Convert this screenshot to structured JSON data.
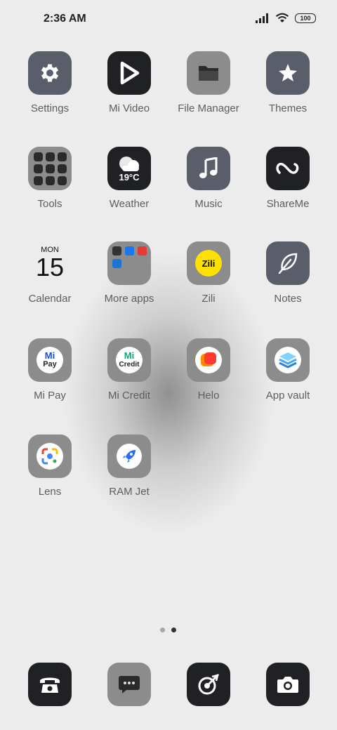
{
  "status": {
    "time": "2:36 AM",
    "battery": "100"
  },
  "apps": {
    "settings": "Settings",
    "mi_video": "Mi Video",
    "file_manager": "File Manager",
    "themes": "Themes",
    "tools": "Tools",
    "weather": "Weather",
    "weather_temp": "19°C",
    "music": "Music",
    "shareme": "ShareMe",
    "calendar": "Calendar",
    "calendar_day": "MON",
    "calendar_date": "15",
    "more_apps": "More apps",
    "zili": "Zili",
    "zili_logo": "Zili",
    "notes": "Notes",
    "mi_pay": "Mi Pay",
    "mi_pay_logo_top": "Mi",
    "mi_pay_logo_bottom": "Pay",
    "mi_credit": "Mi Credit",
    "mi_credit_logo_top": "Mi",
    "mi_credit_logo_bottom": "Credit",
    "helo": "Helo",
    "app_vault": "App vault",
    "lens": "Lens",
    "ram_jet": "RAM Jet"
  },
  "page_indicator": {
    "current": 2,
    "total": 2
  }
}
